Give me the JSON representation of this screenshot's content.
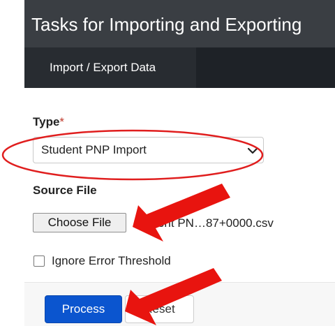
{
  "page": {
    "title": "Tasks for Importing and Exporting"
  },
  "tabs": [
    {
      "label": "Import / Export Data"
    }
  ],
  "form": {
    "type_label": "Type",
    "required_mark": "*",
    "type_value": "Student PNP Import",
    "source_label": "Source File",
    "choose_file_label": "Choose File",
    "file_name": "Student PN…87+0000.csv",
    "ignore_threshold_label": "Ignore Error Threshold",
    "ignore_threshold_checked": false
  },
  "actions": {
    "process_label": "Process",
    "reset_label": "Reset"
  },
  "annotations": {
    "highlight_color": "#e01e1e",
    "arrow_color": "#e8140f"
  },
  "colors": {
    "primary": "#0b55cf",
    "header": "#3a3e43",
    "tab_strip": "#1e2227"
  }
}
